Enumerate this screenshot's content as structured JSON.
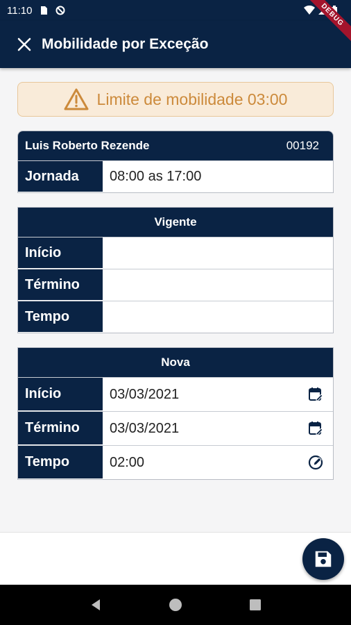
{
  "status_bar": {
    "time": "11:10"
  },
  "debug_label": "DEBUG",
  "app_bar": {
    "title": "Mobilidade por Exceção"
  },
  "alert": {
    "text": "Limite de mobilidade 03:00"
  },
  "employee": {
    "name": "Luis Roberto Rezende",
    "code": "00192",
    "rows": [
      {
        "label": "Jornada",
        "value": "08:00 as 17:00"
      }
    ]
  },
  "vigente": {
    "header": "Vigente",
    "rows": [
      {
        "label": "Início",
        "value": ""
      },
      {
        "label": "Término",
        "value": ""
      },
      {
        "label": "Tempo",
        "value": ""
      }
    ]
  },
  "nova": {
    "header": "Nova",
    "rows": [
      {
        "label": "Início",
        "value": "03/03/2021",
        "icon": "calendar-edit-icon"
      },
      {
        "label": "Término",
        "value": "03/03/2021",
        "icon": "calendar-edit-icon"
      },
      {
        "label": "Tempo",
        "value": "02:00",
        "icon": "clock-edit-icon"
      }
    ]
  },
  "colors": {
    "primary": "#0a2344",
    "alert_bg": "#f9ebd9",
    "alert_text": "#cc8a3b",
    "debug": "#a3142c"
  }
}
